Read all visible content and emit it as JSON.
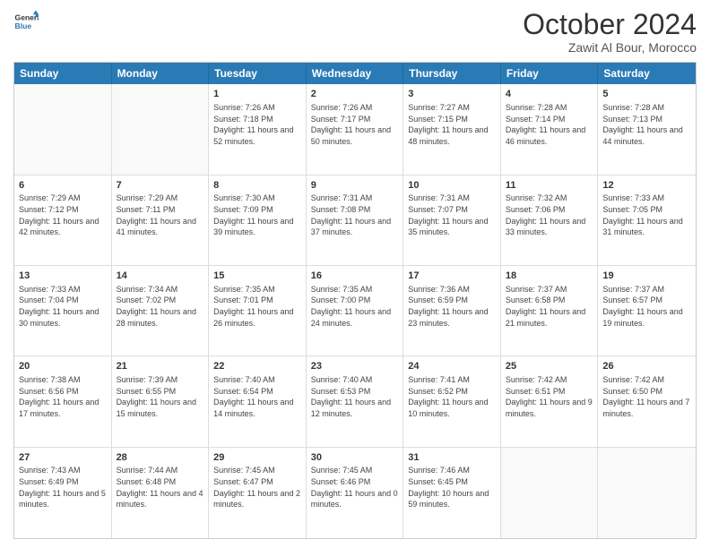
{
  "logo": {
    "line1": "General",
    "line2": "Blue"
  },
  "title": "October 2024",
  "location": "Zawit Al Bour, Morocco",
  "days": [
    "Sunday",
    "Monday",
    "Tuesday",
    "Wednesday",
    "Thursday",
    "Friday",
    "Saturday"
  ],
  "weeks": [
    [
      {
        "day": "",
        "sunrise": "",
        "sunset": "",
        "daylight": "",
        "empty": true
      },
      {
        "day": "",
        "sunrise": "",
        "sunset": "",
        "daylight": "",
        "empty": true
      },
      {
        "day": "1",
        "sunrise": "Sunrise: 7:26 AM",
        "sunset": "Sunset: 7:18 PM",
        "daylight": "Daylight: 11 hours and 52 minutes."
      },
      {
        "day": "2",
        "sunrise": "Sunrise: 7:26 AM",
        "sunset": "Sunset: 7:17 PM",
        "daylight": "Daylight: 11 hours and 50 minutes."
      },
      {
        "day": "3",
        "sunrise": "Sunrise: 7:27 AM",
        "sunset": "Sunset: 7:15 PM",
        "daylight": "Daylight: 11 hours and 48 minutes."
      },
      {
        "day": "4",
        "sunrise": "Sunrise: 7:28 AM",
        "sunset": "Sunset: 7:14 PM",
        "daylight": "Daylight: 11 hours and 46 minutes."
      },
      {
        "day": "5",
        "sunrise": "Sunrise: 7:28 AM",
        "sunset": "Sunset: 7:13 PM",
        "daylight": "Daylight: 11 hours and 44 minutes."
      }
    ],
    [
      {
        "day": "6",
        "sunrise": "Sunrise: 7:29 AM",
        "sunset": "Sunset: 7:12 PM",
        "daylight": "Daylight: 11 hours and 42 minutes."
      },
      {
        "day": "7",
        "sunrise": "Sunrise: 7:29 AM",
        "sunset": "Sunset: 7:11 PM",
        "daylight": "Daylight: 11 hours and 41 minutes."
      },
      {
        "day": "8",
        "sunrise": "Sunrise: 7:30 AM",
        "sunset": "Sunset: 7:09 PM",
        "daylight": "Daylight: 11 hours and 39 minutes."
      },
      {
        "day": "9",
        "sunrise": "Sunrise: 7:31 AM",
        "sunset": "Sunset: 7:08 PM",
        "daylight": "Daylight: 11 hours and 37 minutes."
      },
      {
        "day": "10",
        "sunrise": "Sunrise: 7:31 AM",
        "sunset": "Sunset: 7:07 PM",
        "daylight": "Daylight: 11 hours and 35 minutes."
      },
      {
        "day": "11",
        "sunrise": "Sunrise: 7:32 AM",
        "sunset": "Sunset: 7:06 PM",
        "daylight": "Daylight: 11 hours and 33 minutes."
      },
      {
        "day": "12",
        "sunrise": "Sunrise: 7:33 AM",
        "sunset": "Sunset: 7:05 PM",
        "daylight": "Daylight: 11 hours and 31 minutes."
      }
    ],
    [
      {
        "day": "13",
        "sunrise": "Sunrise: 7:33 AM",
        "sunset": "Sunset: 7:04 PM",
        "daylight": "Daylight: 11 hours and 30 minutes."
      },
      {
        "day": "14",
        "sunrise": "Sunrise: 7:34 AM",
        "sunset": "Sunset: 7:02 PM",
        "daylight": "Daylight: 11 hours and 28 minutes."
      },
      {
        "day": "15",
        "sunrise": "Sunrise: 7:35 AM",
        "sunset": "Sunset: 7:01 PM",
        "daylight": "Daylight: 11 hours and 26 minutes."
      },
      {
        "day": "16",
        "sunrise": "Sunrise: 7:35 AM",
        "sunset": "Sunset: 7:00 PM",
        "daylight": "Daylight: 11 hours and 24 minutes."
      },
      {
        "day": "17",
        "sunrise": "Sunrise: 7:36 AM",
        "sunset": "Sunset: 6:59 PM",
        "daylight": "Daylight: 11 hours and 23 minutes."
      },
      {
        "day": "18",
        "sunrise": "Sunrise: 7:37 AM",
        "sunset": "Sunset: 6:58 PM",
        "daylight": "Daylight: 11 hours and 21 minutes."
      },
      {
        "day": "19",
        "sunrise": "Sunrise: 7:37 AM",
        "sunset": "Sunset: 6:57 PM",
        "daylight": "Daylight: 11 hours and 19 minutes."
      }
    ],
    [
      {
        "day": "20",
        "sunrise": "Sunrise: 7:38 AM",
        "sunset": "Sunset: 6:56 PM",
        "daylight": "Daylight: 11 hours and 17 minutes."
      },
      {
        "day": "21",
        "sunrise": "Sunrise: 7:39 AM",
        "sunset": "Sunset: 6:55 PM",
        "daylight": "Daylight: 11 hours and 15 minutes."
      },
      {
        "day": "22",
        "sunrise": "Sunrise: 7:40 AM",
        "sunset": "Sunset: 6:54 PM",
        "daylight": "Daylight: 11 hours and 14 minutes."
      },
      {
        "day": "23",
        "sunrise": "Sunrise: 7:40 AM",
        "sunset": "Sunset: 6:53 PM",
        "daylight": "Daylight: 11 hours and 12 minutes."
      },
      {
        "day": "24",
        "sunrise": "Sunrise: 7:41 AM",
        "sunset": "Sunset: 6:52 PM",
        "daylight": "Daylight: 11 hours and 10 minutes."
      },
      {
        "day": "25",
        "sunrise": "Sunrise: 7:42 AM",
        "sunset": "Sunset: 6:51 PM",
        "daylight": "Daylight: 11 hours and 9 minutes."
      },
      {
        "day": "26",
        "sunrise": "Sunrise: 7:42 AM",
        "sunset": "Sunset: 6:50 PM",
        "daylight": "Daylight: 11 hours and 7 minutes."
      }
    ],
    [
      {
        "day": "27",
        "sunrise": "Sunrise: 7:43 AM",
        "sunset": "Sunset: 6:49 PM",
        "daylight": "Daylight: 11 hours and 5 minutes."
      },
      {
        "day": "28",
        "sunrise": "Sunrise: 7:44 AM",
        "sunset": "Sunset: 6:48 PM",
        "daylight": "Daylight: 11 hours and 4 minutes."
      },
      {
        "day": "29",
        "sunrise": "Sunrise: 7:45 AM",
        "sunset": "Sunset: 6:47 PM",
        "daylight": "Daylight: 11 hours and 2 minutes."
      },
      {
        "day": "30",
        "sunrise": "Sunrise: 7:45 AM",
        "sunset": "Sunset: 6:46 PM",
        "daylight": "Daylight: 11 hours and 0 minutes."
      },
      {
        "day": "31",
        "sunrise": "Sunrise: 7:46 AM",
        "sunset": "Sunset: 6:45 PM",
        "daylight": "Daylight: 10 hours and 59 minutes."
      },
      {
        "day": "",
        "sunrise": "",
        "sunset": "",
        "daylight": "",
        "empty": true
      },
      {
        "day": "",
        "sunrise": "",
        "sunset": "",
        "daylight": "",
        "empty": true
      }
    ]
  ]
}
